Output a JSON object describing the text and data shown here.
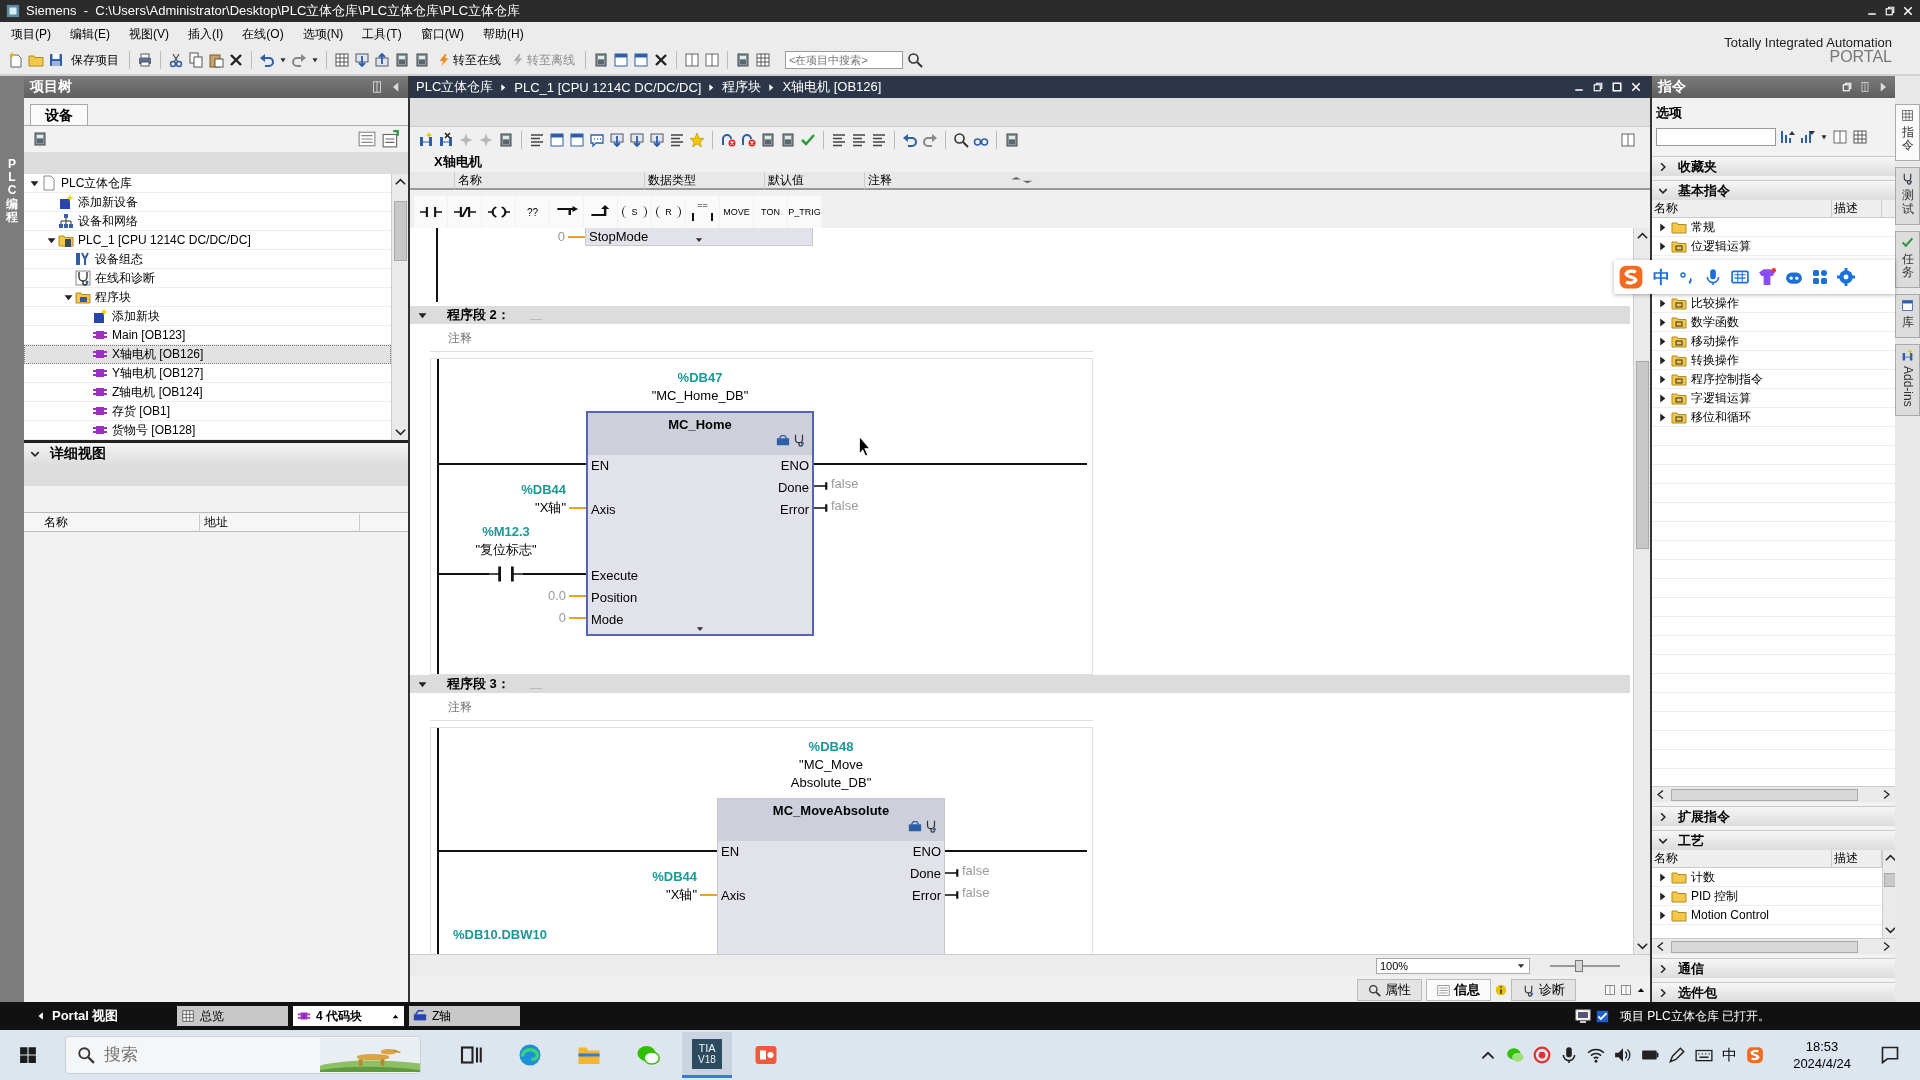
{
  "window": {
    "title": "Siemens  -  C:\\Users\\Administrator\\Desktop\\PLC立体仓库\\PLC立体仓库\\PLC立体仓库"
  },
  "menu": [
    "项目(P)",
    "编辑(E)",
    "视图(V)",
    "插入(I)",
    "在线(O)",
    "选项(N)",
    "工具(T)",
    "窗口(W)",
    "帮助(H)"
  ],
  "toolbar": {
    "save": {
      "label": "保存项目",
      "disabled": false
    },
    "online": {
      "label": "转至在线",
      "disabled": false
    },
    "offline": {
      "label": "转至离线",
      "disabled": true
    },
    "search": {
      "placeholder": "<在项目中搜索>"
    }
  },
  "brand": {
    "line1": "Totally Integrated Automation",
    "line2": "PORTAL"
  },
  "side_tab": {
    "label": "PLC 编程"
  },
  "project_tree": {
    "title": "项目树",
    "tabs": [
      {
        "label": "设备",
        "selected": true
      }
    ],
    "items": [
      {
        "label": "PLC立体仓库",
        "kind": "project",
        "expanded": true,
        "selected": false,
        "children": [
          {
            "label": "添加新设备",
            "kind": "add-device",
            "selected": false
          },
          {
            "label": "设备和网络",
            "kind": "network",
            "selected": false
          },
          {
            "label": "PLC_1 [CPU 1214C DC/DC/DC]",
            "kind": "plc",
            "expanded": true,
            "selected": false,
            "children": [
              {
                "label": "设备组态",
                "kind": "device-config",
                "selected": false
              },
              {
                "label": "在线和诊断",
                "kind": "diagnostics",
                "selected": false
              },
              {
                "label": "程序块",
                "kind": "block-folder",
                "expanded": true,
                "selected": false,
                "children": [
                  {
                    "label": "添加新块",
                    "kind": "add-block",
                    "selected": false
                  },
                  {
                    "label": "Main [OB123]",
                    "kind": "ob",
                    "selected": false
                  },
                  {
                    "label": "X轴电机 [OB126]",
                    "kind": "ob",
                    "selected": true
                  },
                  {
                    "label": "Y轴电机 [OB127]",
                    "kind": "ob",
                    "selected": false
                  },
                  {
                    "label": "Z轴电机 [OB124]",
                    "kind": "ob",
                    "selected": false
                  },
                  {
                    "label": "存货 [OB1]",
                    "kind": "ob",
                    "selected": false
                  },
                  {
                    "label": "货物号 [OB128]",
                    "kind": "ob",
                    "selected": false
                  }
                ]
              }
            ]
          }
        ]
      }
    ]
  },
  "details_view": {
    "title": "详细视图",
    "expanded": true,
    "columns": [
      "名称",
      "地址"
    ]
  },
  "editor": {
    "breadcrumb": [
      "PLC立体仓库",
      "PLC_1 [CPU 1214C DC/DC/DC]",
      "程序块",
      "X轴电机 [OB126]"
    ],
    "block_title": "X轴电机",
    "interface_columns": [
      "名称",
      "数据类型",
      "默认值",
      "注释"
    ],
    "favorites": [
      {
        "kind": "no_contact"
      },
      {
        "kind": "nc_contact"
      },
      {
        "kind": "coil"
      },
      {
        "kind": "empty_box",
        "text": "??"
      },
      {
        "kind": "open_branch"
      },
      {
        "kind": "close_branch"
      },
      {
        "kind": "set_coil",
        "text": "S"
      },
      {
        "kind": "reset_coil",
        "text": "R"
      },
      {
        "kind": "compare",
        "text": "=="
      },
      {
        "kind": "box",
        "text": "MOVE"
      },
      {
        "kind": "box",
        "text": "TON"
      },
      {
        "kind": "box",
        "text": "P_TRIG"
      }
    ],
    "networks": [
      {
        "kind": "tail",
        "block": {
          "selected": false,
          "more": true,
          "inputs": [
            {
              "kind": "value",
              "value": "0",
              "pin": "StopMode"
            }
          ]
        }
      },
      {
        "kind": "full",
        "title": "程序段 2：",
        "expanded": true,
        "comment": "注释",
        "block": {
          "instance": "%DB47",
          "instance_name": "\"MC_Home_DB\"",
          "type": "MC_Home",
          "selected": true,
          "more": true,
          "inputs": [
            {
              "pin": "EN",
              "kind": "power"
            },
            {
              "pin": "Axis",
              "kind": "operand",
              "address": "%DB44",
              "symbol": "\"X轴\""
            },
            {
              "pin": "Execute",
              "kind": "contact",
              "address": "%M12.3",
              "symbol": "\"复位标志\""
            },
            {
              "pin": "Position",
              "kind": "value",
              "value": "0.0"
            },
            {
              "pin": "Mode",
              "kind": "value",
              "value": "0"
            }
          ],
          "outputs": [
            {
              "pin": "ENO",
              "kind": "power"
            },
            {
              "pin": "Done",
              "kind": "value",
              "value": "false"
            },
            {
              "pin": "Error",
              "kind": "value",
              "value": "false"
            }
          ]
        }
      },
      {
        "kind": "full",
        "title": "程序段 3：",
        "expanded": true,
        "comment": "注释",
        "block": {
          "instance": "%DB48",
          "instance_name": "\"MC_Move\nAbsolute_DB\"",
          "type": "MC_MoveAbsolute",
          "selected": false,
          "more": false,
          "inputs": [
            {
              "pin": "EN",
              "kind": "power"
            },
            {
              "pin": "Axis",
              "kind": "operand",
              "address": "%DB44",
              "symbol": "\"X轴\""
            },
            {
              "kind": "cut",
              "address": "%DB10.DBW10"
            }
          ],
          "outputs": [
            {
              "pin": "ENO",
              "kind": "power"
            },
            {
              "pin": "Done",
              "kind": "value",
              "value": "false"
            },
            {
              "pin": "Error",
              "kind": "value",
              "value": "false"
            }
          ]
        }
      }
    ],
    "zoom": "100%",
    "zoom_slider": {
      "level": 0.4
    },
    "inspector_tabs": [
      {
        "label": "属性",
        "selected": false
      },
      {
        "label": "信息",
        "selected": true
      },
      {
        "label": "诊断",
        "selected": false
      }
    ]
  },
  "instructions": {
    "title": "指令",
    "options_label": "选项",
    "sections": [
      {
        "title": "收藏夹",
        "expanded": false
      },
      {
        "title": "基本指令",
        "expanded": true,
        "columns": [
          "名称",
          "描述"
        ],
        "items": [
          {
            "label": "常规",
            "kind": "folder"
          },
          {
            "label": "位逻辑运算",
            "kind": "instruction-folder"
          },
          {
            "label": "比较操作",
            "kind": "instruction-folder"
          },
          {
            "label": "数学函数",
            "kind": "instruction-folder"
          },
          {
            "label": "移动操作",
            "kind": "instruction-folder"
          },
          {
            "label": "转换操作",
            "kind": "instruction-folder"
          },
          {
            "label": "程序控制指令",
            "kind": "instruction-folder"
          },
          {
            "label": "字逻辑运算",
            "kind": "instruction-folder"
          },
          {
            "label": "移位和循环",
            "kind": "instruction-folder"
          }
        ]
      },
      {
        "title": "扩展指令",
        "expanded": false
      },
      {
        "title": "工艺",
        "expanded": true,
        "columns": [
          "名称",
          "描述"
        ],
        "items": [
          {
            "label": "计数",
            "kind": "folder"
          },
          {
            "label": "PID 控制",
            "kind": "folder"
          },
          {
            "label": "Motion Control",
            "kind": "folder"
          }
        ]
      },
      {
        "title": "通信",
        "expanded": false
      },
      {
        "title": "选件包",
        "expanded": false
      }
    ]
  },
  "right_tabs": [
    {
      "label": "指令",
      "selected": true
    },
    {
      "label": "测试",
      "selected": false
    },
    {
      "label": "任务",
      "selected": false
    },
    {
      "label": "库",
      "selected": false
    },
    {
      "label": "Add-ins",
      "selected": false
    }
  ],
  "ime_bar": {
    "mode": "中"
  },
  "portal_bar": {
    "portal_label": "Portal 视图",
    "tabs": [
      {
        "label": "总览",
        "kind": "overview",
        "selected": false
      },
      {
        "label": "4 代码块",
        "kind": "blocks",
        "selected": true
      },
      {
        "label": "Z轴",
        "kind": "axis",
        "selected": false
      }
    ],
    "status": "项目 PLC立体仓库 已打开。"
  },
  "taskbar": {
    "search_placeholder": "搜索",
    "apps": [
      {
        "kind": "task-view",
        "active": false
      },
      {
        "kind": "edge",
        "active": false
      },
      {
        "kind": "explorer",
        "active": false
      },
      {
        "kind": "wechat",
        "active": false
      },
      {
        "kind": "tia",
        "label": "TIA",
        "sublabel": "V18",
        "active": true
      },
      {
        "kind": "slides",
        "active": false
      }
    ],
    "ime": "中",
    "time": "18:53",
    "date": "2024/4/24"
  }
}
